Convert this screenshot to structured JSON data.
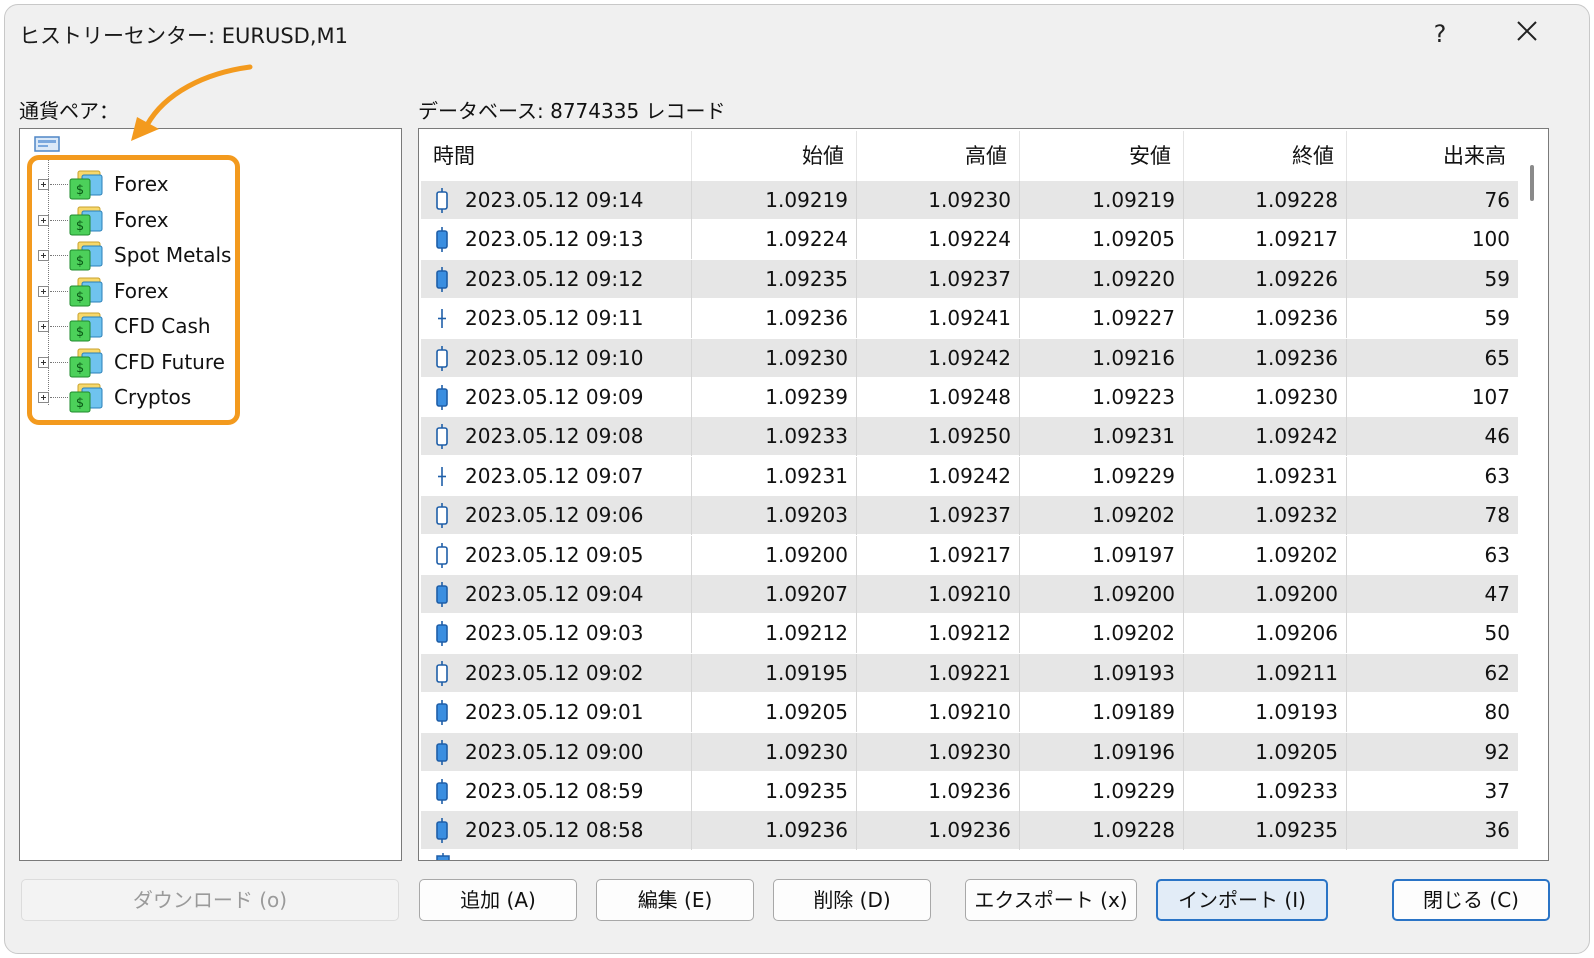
{
  "window": {
    "title": "ヒストリーセンター: EURUSD,M1",
    "help_label": "?",
    "close_icon": "close-icon"
  },
  "left": {
    "label": "通貨ペア：",
    "tree_items": [
      {
        "label": "Forex"
      },
      {
        "label": "Forex"
      },
      {
        "label": "Spot Metals"
      },
      {
        "label": "Forex"
      },
      {
        "label": "CFD Cash"
      },
      {
        "label": "CFD Future"
      },
      {
        "label": "Cryptos"
      }
    ],
    "highlight_color": "#f39a1e"
  },
  "right": {
    "db_label": "データベース: 8774335 レコード",
    "columns": [
      "時間",
      "始値",
      "高値",
      "安値",
      "終値",
      "出来高"
    ],
    "rows": [
      {
        "candle": "bull",
        "time": "2023.05.12 09:14",
        "open": "1.09219",
        "high": "1.09230",
        "low": "1.09219",
        "close": "1.09228",
        "volume": "76"
      },
      {
        "candle": "bear",
        "time": "2023.05.12 09:13",
        "open": "1.09224",
        "high": "1.09224",
        "low": "1.09205",
        "close": "1.09217",
        "volume": "100"
      },
      {
        "candle": "bear",
        "time": "2023.05.12 09:12",
        "open": "1.09235",
        "high": "1.09237",
        "low": "1.09220",
        "close": "1.09226",
        "volume": "59"
      },
      {
        "candle": "doji",
        "time": "2023.05.12 09:11",
        "open": "1.09236",
        "high": "1.09241",
        "low": "1.09227",
        "close": "1.09236",
        "volume": "59"
      },
      {
        "candle": "bull",
        "time": "2023.05.12 09:10",
        "open": "1.09230",
        "high": "1.09242",
        "low": "1.09216",
        "close": "1.09236",
        "volume": "65"
      },
      {
        "candle": "bear",
        "time": "2023.05.12 09:09",
        "open": "1.09239",
        "high": "1.09248",
        "low": "1.09223",
        "close": "1.09230",
        "volume": "107"
      },
      {
        "candle": "bull",
        "time": "2023.05.12 09:08",
        "open": "1.09233",
        "high": "1.09250",
        "low": "1.09231",
        "close": "1.09242",
        "volume": "46"
      },
      {
        "candle": "doji",
        "time": "2023.05.12 09:07",
        "open": "1.09231",
        "high": "1.09242",
        "low": "1.09229",
        "close": "1.09231",
        "volume": "63"
      },
      {
        "candle": "bull",
        "time": "2023.05.12 09:06",
        "open": "1.09203",
        "high": "1.09237",
        "low": "1.09202",
        "close": "1.09232",
        "volume": "78"
      },
      {
        "candle": "bull",
        "time": "2023.05.12 09:05",
        "open": "1.09200",
        "high": "1.09217",
        "low": "1.09197",
        "close": "1.09202",
        "volume": "63"
      },
      {
        "candle": "bear",
        "time": "2023.05.12 09:04",
        "open": "1.09207",
        "high": "1.09210",
        "low": "1.09200",
        "close": "1.09200",
        "volume": "47"
      },
      {
        "candle": "bear",
        "time": "2023.05.12 09:03",
        "open": "1.09212",
        "high": "1.09212",
        "low": "1.09202",
        "close": "1.09206",
        "volume": "50"
      },
      {
        "candle": "bull",
        "time": "2023.05.12 09:02",
        "open": "1.09195",
        "high": "1.09221",
        "low": "1.09193",
        "close": "1.09211",
        "volume": "62"
      },
      {
        "candle": "bear",
        "time": "2023.05.12 09:01",
        "open": "1.09205",
        "high": "1.09210",
        "low": "1.09189",
        "close": "1.09193",
        "volume": "80"
      },
      {
        "candle": "bear",
        "time": "2023.05.12 09:00",
        "open": "1.09230",
        "high": "1.09230",
        "low": "1.09196",
        "close": "1.09205",
        "volume": "92"
      },
      {
        "candle": "bear",
        "time": "2023.05.12 08:59",
        "open": "1.09235",
        "high": "1.09236",
        "low": "1.09229",
        "close": "1.09233",
        "volume": "37"
      },
      {
        "candle": "bear",
        "time": "2023.05.12 08:58",
        "open": "1.09236",
        "high": "1.09236",
        "low": "1.09228",
        "close": "1.09235",
        "volume": "36"
      }
    ]
  },
  "buttons": {
    "download": "ダウンロード (o)",
    "add": "追加 (A)",
    "edit": "編集 (E)",
    "delete": "削除 (D)",
    "export": "エクスポート (x)",
    "import": "インポート (I)",
    "close": "閉じる (C)"
  },
  "colors": {
    "accent_blue": "#2a74c6",
    "candle_fill": "#3a8ee0",
    "row_alt": "#e6e6e6"
  }
}
